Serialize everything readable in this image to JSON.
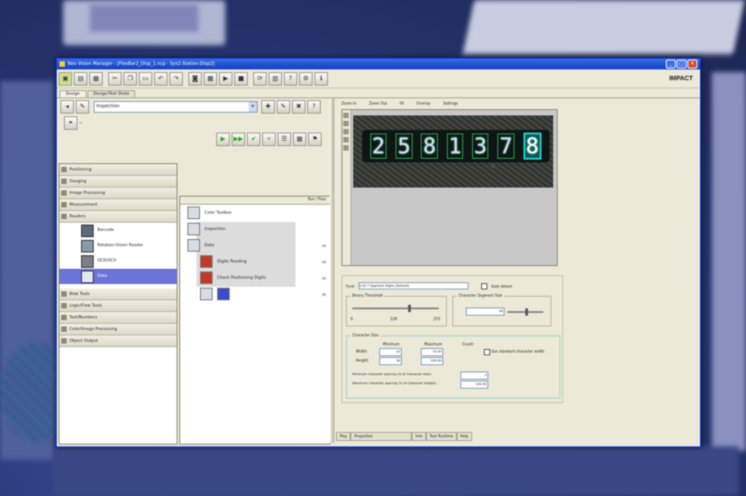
{
  "window": {
    "title": "Neo Vision Manager - [FlexBar2_Disp_1.ncp - Sys2-Station-Disp2]",
    "logo": "IMPACT"
  },
  "tabs": [
    "Design",
    "Design/Test Shots"
  ],
  "toolbar_icons": [
    "open-icon",
    "save-icon",
    "print-icon",
    "cut-icon",
    "copy-icon",
    "paste-icon",
    "undo-icon",
    "redo-icon",
    "camera-icon",
    "image-icon",
    "play-icon",
    "stop-icon",
    "run-icon",
    "chart-icon",
    "help-icon",
    "settings-icon"
  ],
  "left": {
    "dropdown_value": "Inspection",
    "categories_top": [
      "Positioning",
      "Gauging",
      "Image Processing",
      "Measurement",
      "Readers"
    ],
    "reader_items": [
      "Barcode",
      "Rotation-Vision Reader",
      "OCR/OCV",
      "Data"
    ],
    "categories_bottom": [
      "Blob Tools",
      "Logic/Flow Tools",
      "Text/Numbers",
      "Color/Image Processing",
      "Object Output"
    ],
    "tree_header": "Run / Pass",
    "tree_nodes": [
      {
        "label": "Color Toolbox",
        "count": ""
      },
      {
        "label": "Inspection",
        "count": ""
      },
      {
        "label": "Data",
        "count": "ok"
      },
      {
        "label": "Digits Reading",
        "count": "ok"
      },
      {
        "label": "Check Positioning Digits",
        "count": "ok"
      },
      {
        "label": "",
        "count": "ok"
      }
    ]
  },
  "right": {
    "view_tools": [
      "Zoom In",
      "Zoom Out",
      "Fit",
      "Overlay",
      "Settings"
    ],
    "display_digits": [
      "2",
      "5",
      "8",
      "1",
      "3",
      "7",
      "8"
    ],
    "highlight_index": 6,
    "params": {
      "font_label": "Font:",
      "font_value": "LCD 7 Segment Digits (Default)",
      "auto_label": "Auto detect",
      "threshold_label": "Binary Threshold",
      "slider_min": "0",
      "slider_mid": "128",
      "slider_max": "255",
      "char_label": "Character Segment Size",
      "char_value": "16",
      "range_label": "Character Size",
      "col_min": "Minimum",
      "col_max": "Maximum",
      "row_width": "Width:",
      "row_height": "Height:",
      "w_min": "10",
      "w_max": "70.00",
      "h_min": "18",
      "h_max": "100.00",
      "count_label": "Count:",
      "expected_label": "Use standard character width",
      "min_label": "Minimum character spacing (% of Character Size):",
      "min_value": "3",
      "max_label": "Maximum character spacing (% of Character Height):",
      "max_value": "100.00"
    },
    "status": [
      "Play",
      "Properties",
      "Info",
      "Test Runtime",
      "Help"
    ]
  }
}
